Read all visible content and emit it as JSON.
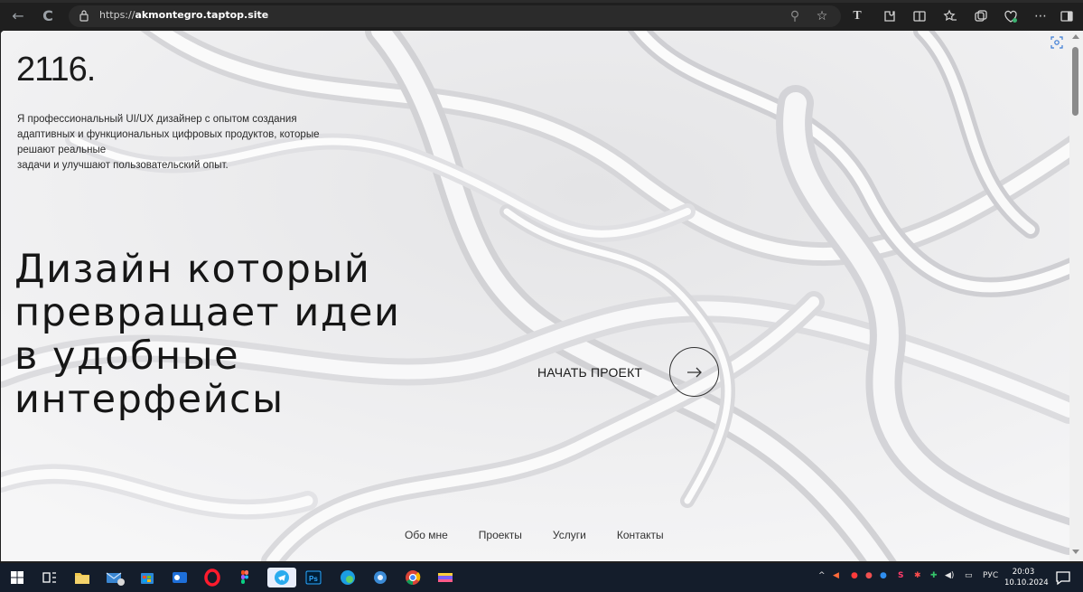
{
  "browser": {
    "url_prefix": "https://",
    "url_domain": "akmontegro.taptop.site",
    "back_icon": "←",
    "refresh_icon": "C",
    "zoom_icon": "⚲",
    "star_icon": "☆",
    "reader_icon": "T"
  },
  "page": {
    "brand": "2116.",
    "intro": "Я профессиональный UI/UX дизайнер с опытом создания\nадаптивных и функциональных цифровых продуктов, которые\nрешают реальные\nзадачи и улучшают пользовательский опыт.",
    "hero": "Дизайн который\nпревращает идеи\nв удобные\nинтерфейсы",
    "cta_label": "НАЧАТЬ ПРОЕКТ",
    "nav": [
      "Обо мне",
      "Проекты",
      "Услуги",
      "Контакты"
    ]
  },
  "taskbar": {
    "language": "РУС",
    "time": "20:03",
    "date": "10.10.2024"
  }
}
